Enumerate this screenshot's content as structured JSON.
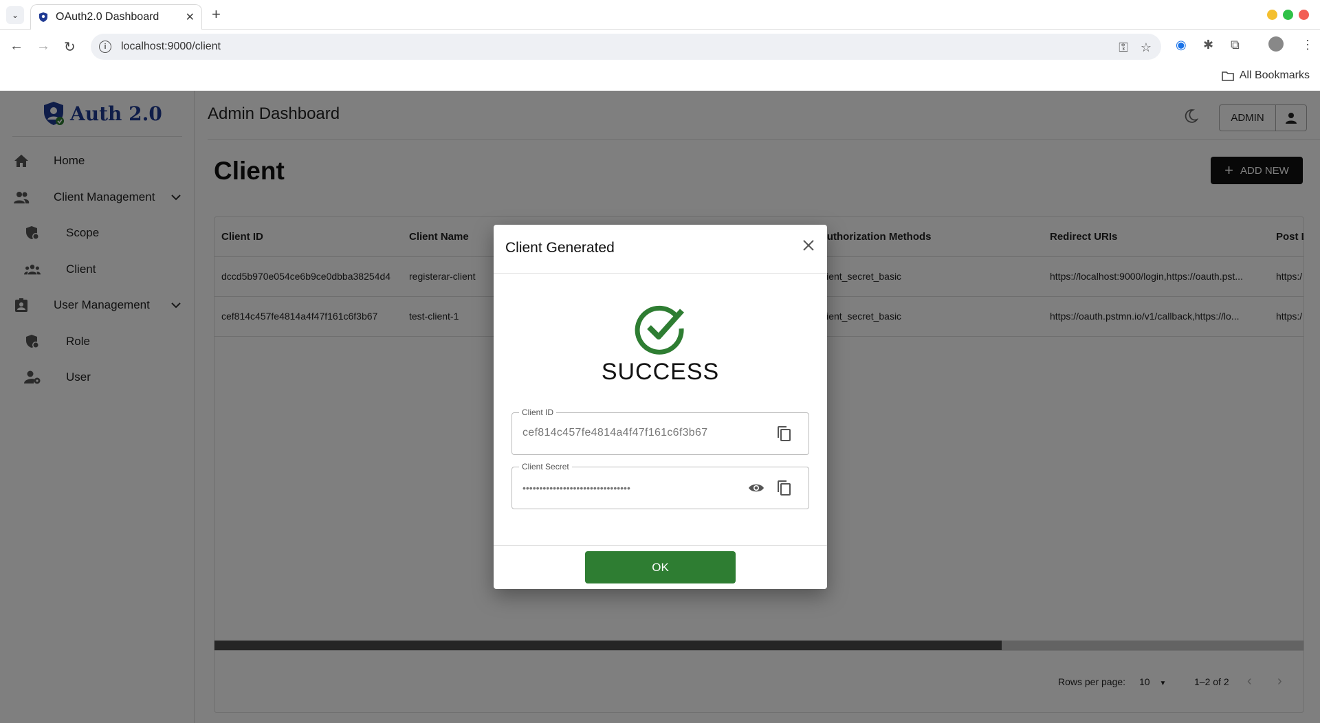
{
  "browser": {
    "tab_title": "OAuth2.0 Dashboard",
    "url": "localhost:9000/client",
    "bookmarks_label": "All Bookmarks"
  },
  "app": {
    "logo_text": "Auth 2.0",
    "header_title": "Admin Dashboard",
    "admin_label": "ADMIN",
    "page_title": "Client",
    "add_new_label": "ADD NEW"
  },
  "sidebar": {
    "items": [
      {
        "label": "Home",
        "icon": "home-icon"
      },
      {
        "label": "Client Management",
        "icon": "people-icon"
      },
      {
        "label": "Scope",
        "icon": "shield-lock-icon"
      },
      {
        "label": "Client",
        "icon": "groups-icon"
      },
      {
        "label": "User Management",
        "icon": "badge-icon"
      },
      {
        "label": "Role",
        "icon": "shield-lock-icon"
      },
      {
        "label": "User",
        "icon": "user-settings-icon"
      }
    ]
  },
  "table": {
    "columns": [
      "Client ID",
      "Client Name",
      "Authorization Methods",
      "Redirect URIs",
      "Post L"
    ],
    "rows": [
      [
        "dccd5b970e054ce6b9ce0dbba38254d4",
        "registerar-client",
        "client_secret_basic",
        "https://localhost:9000/login,https://oauth.pst...",
        "https:/"
      ],
      [
        "cef814c457fe4814a4f47f161c6f3b67",
        "test-client-1",
        "client_secret_basic",
        "https://oauth.pstmn.io/v1/callback,https://lo...",
        "https:/"
      ]
    ],
    "rows_per_page_label": "Rows per page:",
    "rows_per_page_value": "10",
    "pagination_text": "1–2 of 2"
  },
  "dialog": {
    "title": "Client Generated",
    "status": "SUCCESS",
    "client_id_label": "Client ID",
    "client_id_value": "cef814c457fe4814a4f47f161c6f3b67",
    "client_secret_label": "Client Secret",
    "client_secret_value": "••••••••••••••••••••••••••••••••",
    "ok_label": "OK",
    "success_color": "#2e7d32"
  }
}
